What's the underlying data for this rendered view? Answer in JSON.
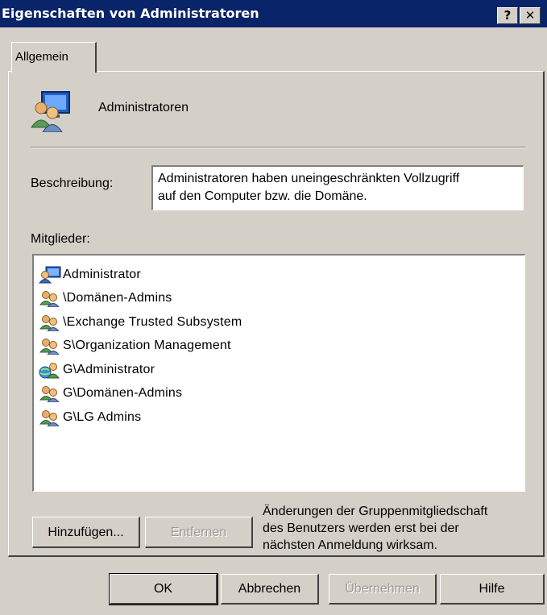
{
  "window": {
    "title": "Eigenschaften von Administratoren",
    "help_label": "?",
    "close_label": "✕"
  },
  "tabs": [
    {
      "label": "Allgemein"
    }
  ],
  "general": {
    "group_name": "Administratoren",
    "description_label": "Beschreibung:",
    "description_line1": "Administratoren haben uneingeschränkten Vollzugriff",
    "description_line2": "auf den Computer bzw. die Domäne.",
    "members_label": "Mitglieder:",
    "members": [
      {
        "name": "Administrator",
        "icon": "user-icon"
      },
      {
        "name": "\\Domänen-Admins",
        "icon": "group-icon"
      },
      {
        "name": "\\Exchange Trusted Subsystem",
        "icon": "group-icon"
      },
      {
        "name": "S\\Organization Management",
        "icon": "group-icon"
      },
      {
        "name": "G\\Administrator",
        "icon": "domain-user-icon"
      },
      {
        "name": "G\\Domänen-Admins",
        "icon": "group-icon"
      },
      {
        "name": "G\\LG Admins",
        "icon": "group-icon"
      }
    ],
    "add_button": "Hinzufügen...",
    "remove_button": "Entfernen",
    "note_line1": "Änderungen der Gruppenmitgliedschaft",
    "note_line2": "des Benutzers werden erst bei der",
    "note_line3": "nächsten Anmeldung wirksam."
  },
  "footer": {
    "ok_button": "OK",
    "cancel_button": "Abbrechen",
    "apply_button": "Übernehmen",
    "help_button": "Hilfe"
  },
  "colors": {
    "titlebar": "#0a246a",
    "face": "#d4d0c8",
    "disabled_text": "#9c9a94"
  }
}
